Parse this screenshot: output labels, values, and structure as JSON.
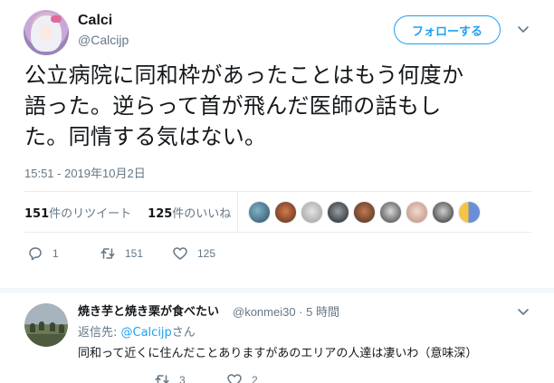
{
  "tweet": {
    "author_name": "Calci",
    "author_handle": "@Calcijp",
    "follow_label": "フォローする",
    "text_line1": "公立病院に同和枠があったことはもう何度か",
    "text_line2": "語った。逆らって首が飛んだ医師の話もし",
    "text_line3": "た。同情する気はない。",
    "timestamp": "15:51 - 2019年10月2日"
  },
  "stats": {
    "retweets_count": "151",
    "retweets_label": "件のリツイート",
    "likes_count": "125",
    "likes_label": "件のいいね"
  },
  "actions": {
    "reply_count": "1",
    "retweet_count": "151",
    "like_count": "125"
  },
  "reply": {
    "author_name": "焼き芋と焼き栗が食べたい",
    "author_handle_time": "@konmei30 · 5 時間",
    "reply_to_prefix": "返信先: ",
    "reply_to_user": "@Calcijp",
    "reply_to_suffix": "さん",
    "text": "同和って近くに住んだことありますがあのエリアの人達は凄いわ（意味深）",
    "retweet_count": "3",
    "like_count": "2"
  },
  "colors": {
    "accent": "#1da1f2",
    "secondary_text": "#657786",
    "primary_text": "#14171a",
    "divider": "#e6ecf0"
  }
}
